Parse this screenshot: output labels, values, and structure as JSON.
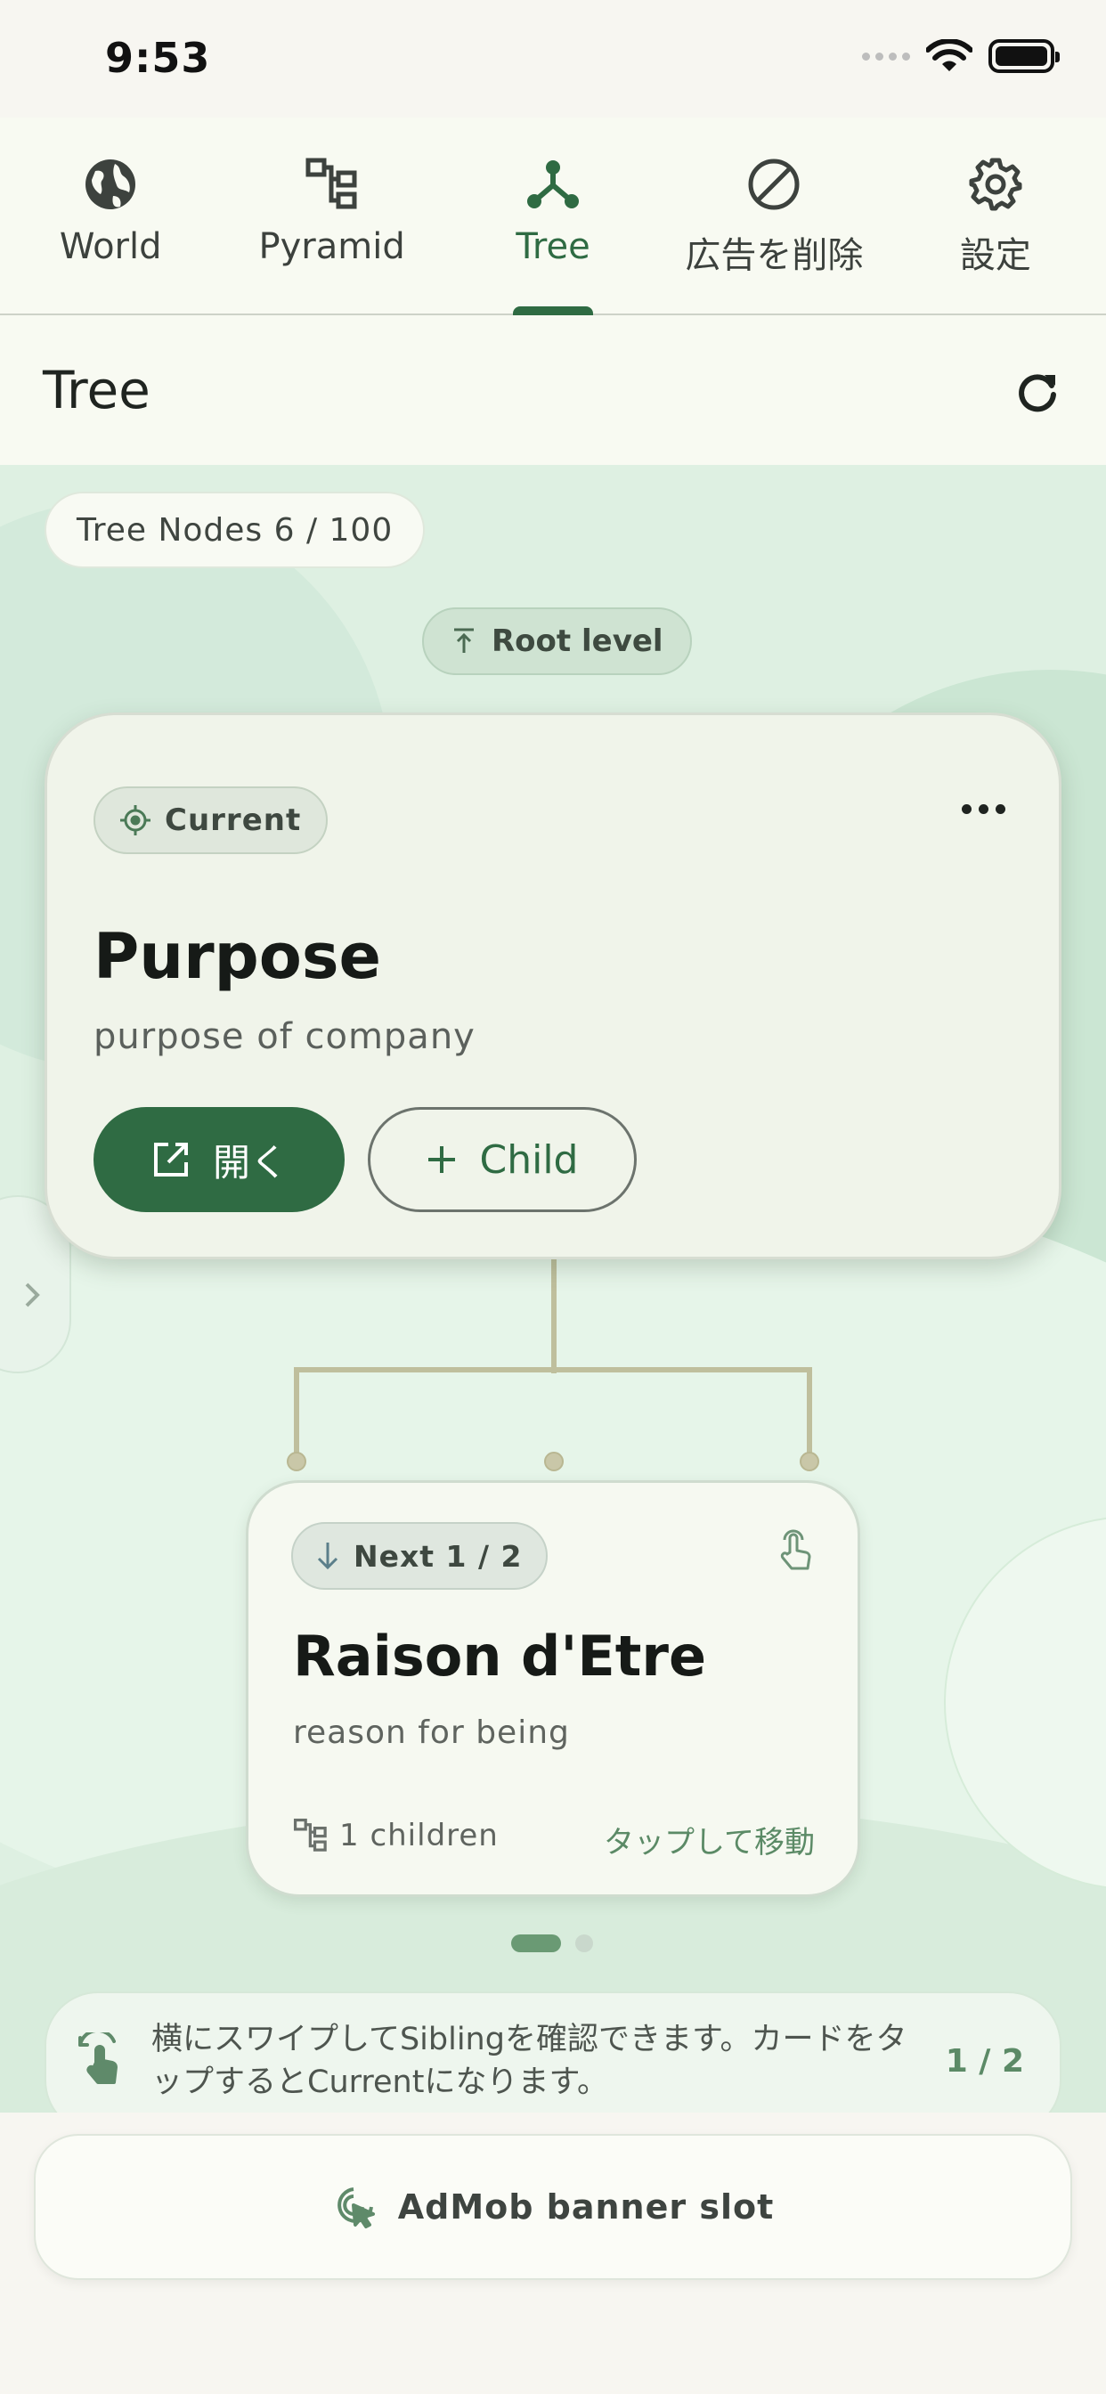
{
  "status_bar": {
    "time": "9:53"
  },
  "tabs": [
    {
      "label": "World",
      "icon": "globe-icon"
    },
    {
      "label": "Pyramid",
      "icon": "hierarchy-icon"
    },
    {
      "label": "Tree",
      "icon": "tree-icon",
      "active": true
    },
    {
      "label": "広告を削除",
      "icon": "block-icon"
    },
    {
      "label": "設定",
      "icon": "gear-icon"
    }
  ],
  "header": {
    "title": "Tree"
  },
  "tree_nodes": "Tree Nodes 6 / 100",
  "root_level": "Root level",
  "current_card": {
    "badge": "Current",
    "title": "Purpose",
    "subtitle": "purpose of company",
    "open_label": "開く",
    "child_label": "Child"
  },
  "next_card": {
    "badge": "Next 1 / 2",
    "title": "Raison d'Etre",
    "subtitle": "reason for being",
    "children": "1 children",
    "tap_to_move": "タップして移動"
  },
  "pager": {
    "count": 2,
    "active": 0
  },
  "hint": {
    "text": "横にスワイプしてSiblingを確認できます。カードをタップするとCurrentになります。",
    "count": "1 / 2"
  },
  "ad": {
    "label": "AdMob banner slot"
  },
  "colors": {
    "accent": "#2f6b43",
    "content_bg": "#def0e2",
    "card_bg": "#f0f4ea"
  }
}
